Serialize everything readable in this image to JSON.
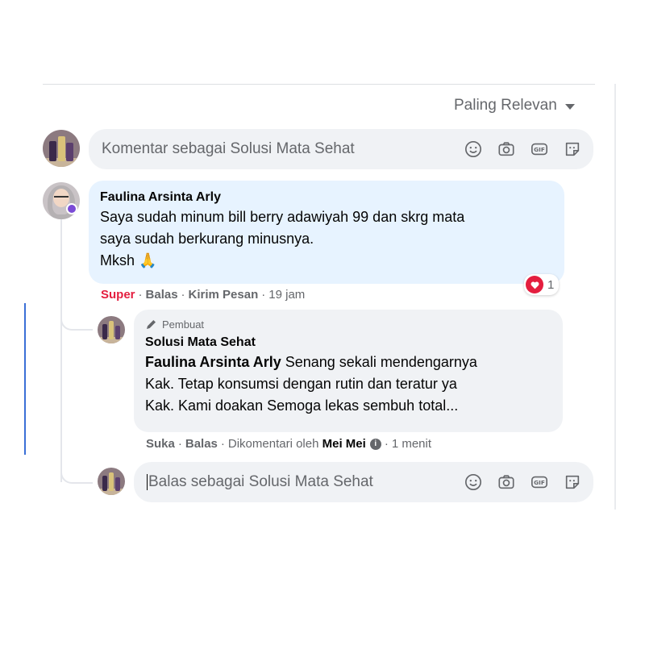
{
  "sort": {
    "label": "Paling Relevan"
  },
  "composer": {
    "placeholder": "Komentar sebagai Solusi Mata Sehat",
    "icons": [
      "emoji-icon",
      "camera-icon",
      "gif-icon",
      "sticker-icon"
    ]
  },
  "comment": {
    "author": "Faulina Arsinta Arly",
    "lines": [
      "Saya sudah minum bill berry adawiyah 99 dan skrg mata",
      "saya sudah berkurang minusnya.",
      "Mksh 🙏"
    ],
    "reaction_count": "1",
    "actions": {
      "reaction": "Super",
      "reply": "Balas",
      "message": "Kirim Pesan",
      "time": "19 jam"
    }
  },
  "reply": {
    "creator_badge": "Pembuat",
    "author": "Solusi Mata Sehat",
    "tagged": "Faulina Arsinta Arly",
    "lines": [
      "Senang sekali mendengarnya",
      "Kak. Tetap konsumsi dengan rutin dan teratur ya",
      "Kak. Kami doakan Semoga lekas sembuh total..."
    ],
    "actions": {
      "like": "Suka",
      "reply": "Balas",
      "commented_by_prefix": "Dikomentari oleh",
      "commented_by": "Mei Mei",
      "time": "1 menit"
    }
  },
  "reply_composer": {
    "placeholder": "Balas sebagai Solusi Mata Sehat"
  },
  "colors": {
    "accent_red": "#e41e3f",
    "bubble_blue": "#e7f3ff",
    "bubble_gray": "#f0f2f5",
    "muted": "#65676b"
  }
}
